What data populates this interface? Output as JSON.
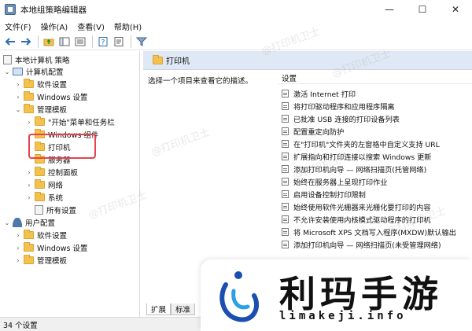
{
  "window": {
    "title": "本地组策略编辑器",
    "minimize": "—",
    "maximize": "☐",
    "close": "✕"
  },
  "menu": [
    "文件(F)",
    "操作(A)",
    "查看(V)",
    "帮助(H)"
  ],
  "watermark": "@打印机卫士",
  "tree": {
    "root": "本地计算机 策略",
    "computer_config": "计算机配置",
    "software_settings": "软件设置",
    "windows_settings": "Windows 设置",
    "admin_templates": "管理模板",
    "start_menu": "\"开始\"菜单和任务栏",
    "windows_components": "Windows 组件",
    "printers": "打印机",
    "server": "服务器",
    "control_panel": "控制面板",
    "network": "网络",
    "system": "系统",
    "all_settings": "所有设置",
    "user_config": "用户配置",
    "user_software_settings": "软件设置",
    "user_windows_settings": "Windows 设置",
    "user_admin_templates": "管理模板"
  },
  "right": {
    "header": "打印机",
    "description": "选择一个项目来查看它的描述。",
    "column": "设置",
    "items": [
      "激活 Internet 打印",
      "将打印驱动程序和应用程序隔离",
      "已批准 USB 连接的打印设备列表",
      "配置重定向防护",
      "在\"打印机\"文件夹的左窗格中自定义支持 URL",
      "扩展指向和打印连接以搜索 Windows 更新",
      "添加打印机向导 — 网络扫描页(托管网络)",
      "始终在服务器上呈现打印作业",
      "启用设备控制打印限制",
      "始终使用软件光栅器来光栅化要打印的内容",
      "不允许安装使用内核模式驱动程序的打印机",
      "将 Microsoft XPS 文档写入程序(MXDW)默认输出",
      "添加打印机向导 — 网络扫描页(未受管理网络)"
    ]
  },
  "tabs": [
    "扩展",
    "标准"
  ],
  "status": "34 个设置",
  "brand": {
    "name": "利玛手游",
    "url": "limakeji.info"
  },
  "colors": {
    "header_bg": "#dfe9f5",
    "highlight": "#e8434b",
    "folder": "#f2c14e"
  }
}
